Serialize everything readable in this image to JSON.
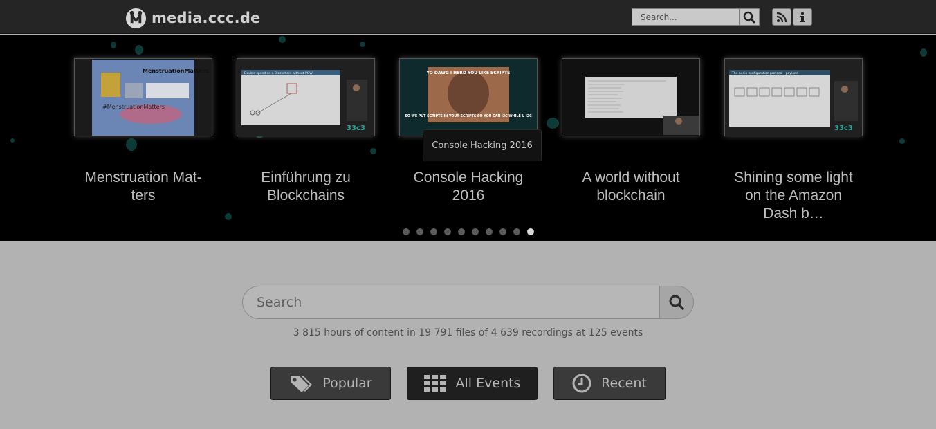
{
  "navbar": {
    "brand": "media.ccc.de",
    "search_placeholder": "Search...",
    "icons": [
      "search-icon",
      "rss-icon",
      "info-icon"
    ]
  },
  "slider": {
    "slides": [
      {
        "title": "Menstruation Mat-ters",
        "title_line1": "Menstruation Mat-",
        "title_line2": "ters",
        "thumb_caption_top": "MenstruationMatters",
        "thumb_caption_bottom": "#MenstruationMatters"
      },
      {
        "title": "Einführung zu Blockchains",
        "title_line1": "Einführung zu",
        "title_line2": "Blockchains",
        "thumb_caption_top": "Double-spend on a Blockchain without POW"
      },
      {
        "title": "Console Hacking 2016",
        "title_line1": "Console Hacking",
        "title_line2": "2016",
        "thumb_caption_top": "YO DAWG I HERD YOU LIKE SCRIPTS",
        "thumb_caption_bottom": "SO WE PUT SCRIPTS IN YOUR SCRIPTS SO YOU CAN I2C WHILE U I2C"
      },
      {
        "title": "A world without blockchain",
        "title_line1": "A world without",
        "title_line2": "blockchain"
      },
      {
        "title": "Shining some light on the Amazon Dash b…",
        "title_line1": "Shining some light",
        "title_line2": "on the Amazon",
        "title_line3": "Dash b…",
        "thumb_caption_top": "The audio configuration protocol - payload"
      }
    ],
    "tooltip": "Console Hacking 2016",
    "pager_count": 10,
    "pager_active": 9,
    "accent": "#0e6a63"
  },
  "main": {
    "search_placeholder": "Search",
    "stats": "3 815 hours of content in 19 791 files of 4 639 recordings at 125 events",
    "buttons": {
      "popular": "Popular",
      "all_events": "All Events",
      "recent": "Recent"
    }
  }
}
